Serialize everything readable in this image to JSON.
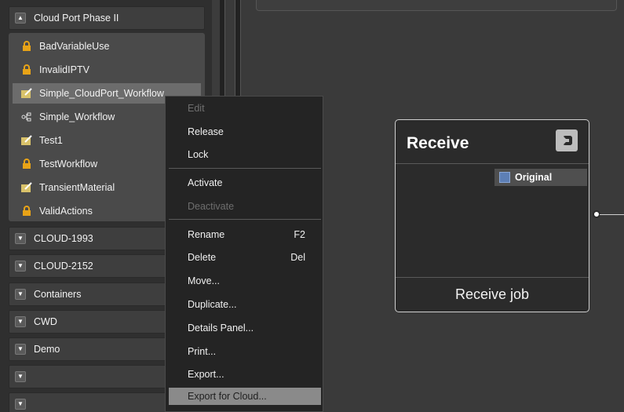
{
  "left_panel": {
    "expanded_group": {
      "title": "Cloud Port Phase II",
      "items": [
        {
          "label": "BadVariableUse",
          "icon": "lock-icon"
        },
        {
          "label": "InvalidIPTV",
          "icon": "lock-icon"
        },
        {
          "label": "Simple_CloudPort_Workflow",
          "icon": "workflow-edit-icon",
          "selected": true
        },
        {
          "label": "Simple_Workflow",
          "icon": "workflow-nodes-icon"
        },
        {
          "label": "Test1",
          "icon": "workflow-edit-icon"
        },
        {
          "label": "TestWorkflow",
          "icon": "lock-icon"
        },
        {
          "label": "TransientMaterial",
          "icon": "workflow-edit-icon"
        },
        {
          "label": "ValidActions",
          "icon": "lock-icon"
        }
      ]
    },
    "collapsed_groups": [
      {
        "title": "CLOUD-1993"
      },
      {
        "title": "CLOUD-2152"
      },
      {
        "title": "Containers"
      },
      {
        "title": "CWD"
      },
      {
        "title": "Demo"
      },
      {
        "title": ""
      },
      {
        "title": ""
      }
    ]
  },
  "context_menu": {
    "edit": "Edit",
    "release": "Release",
    "lock": "Lock",
    "activate": "Activate",
    "deactivate": "Deactivate",
    "rename": "Rename",
    "rename_shortcut": "F2",
    "delete": "Delete",
    "delete_shortcut": "Del",
    "move": "Move...",
    "duplicate": "Duplicate...",
    "details_panel": "Details Panel...",
    "print": "Print...",
    "export": "Export...",
    "export_cloud": "Export for Cloud..."
  },
  "node": {
    "title": "Receive",
    "port_label": "Original",
    "footer": "Receive job"
  },
  "colors": {
    "selection": "#6c6c6c",
    "menu_highlight": "#8a8a8a",
    "lock_icon": "#e8a317"
  }
}
